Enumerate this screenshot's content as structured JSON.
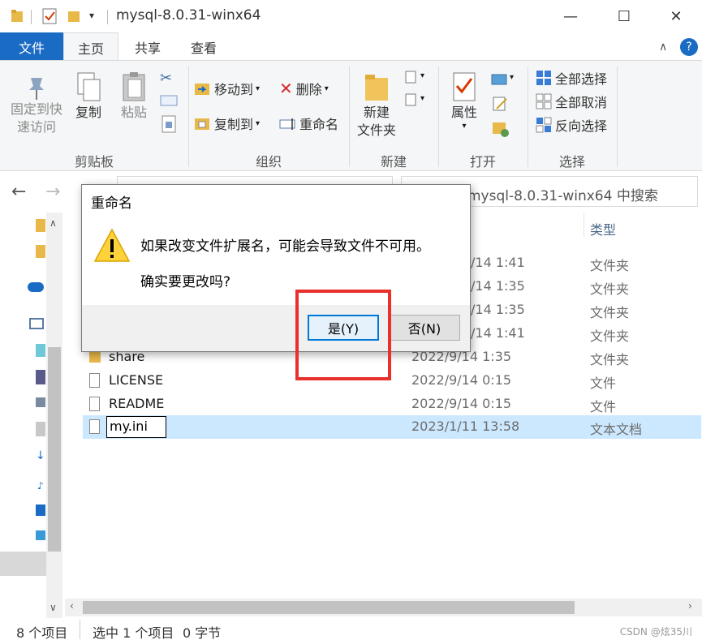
{
  "window": {
    "title": "mysql-8.0.31-winx64",
    "minimize": "—",
    "maximize": "☐",
    "close": "✕"
  },
  "tabs": [
    "文件",
    "主页",
    "共享",
    "查看"
  ],
  "ribbon": {
    "clipboard": {
      "pin_label_1": "固定到快",
      "pin_label_2": "速访问",
      "copy_label": "复制",
      "paste_label": "粘贴",
      "group_label": "剪贴板"
    },
    "organize": {
      "move_to": "移动到",
      "copy_to": "复制到",
      "delete": "删除",
      "rename": "重命名",
      "group_label": "组织"
    },
    "new": {
      "new_folder_1": "新建",
      "new_folder_2": "文件夹",
      "group_label": "新建"
    },
    "open": {
      "properties": "属性",
      "group_label": "打开"
    },
    "select": {
      "select_all": "全部选择",
      "select_none": "全部取消",
      "invert": "反向选择",
      "group_label": "选择"
    }
  },
  "search": {
    "placeholder": "mysql-8.0.31-winx64 中搜索"
  },
  "list": {
    "col_type": "类型",
    "rows": [
      {
        "name": "",
        "date": "2022/9/14 1:41",
        "type": "文件夹"
      },
      {
        "name": "",
        "date": "2022/9/14 1:35",
        "type": "文件夹"
      },
      {
        "name": "",
        "date": "2022/9/14 1:35",
        "type": "文件夹"
      },
      {
        "name": "",
        "date": "2022/9/14 1:41",
        "type": "文件夹"
      },
      {
        "name": "share",
        "date": "2022/9/14 1:35",
        "type": "文件夹"
      },
      {
        "name": "LICENSE",
        "date": "2022/9/14 0:15",
        "type": "文件"
      },
      {
        "name": "README",
        "date": "2022/9/14 0:15",
        "type": "文件"
      },
      {
        "name": "my.ini",
        "date": "2023/1/11 13:58",
        "type": "文本文档"
      }
    ],
    "partial_dates": [
      "/14 1:41",
      "/14 1:35",
      "/14 1:35",
      "/14 1:41"
    ]
  },
  "dialog": {
    "title": "重命名",
    "message": "如果改变文件扩展名，可能会导致文件不可用。",
    "question": "确实要更改吗?",
    "yes_label": "是(Y)",
    "no_label": "否(N)"
  },
  "status": {
    "item_count": "8 个项目",
    "selected": "选中 1 个项目",
    "size": "0 字节"
  },
  "watermark": "CSDN @炫35川",
  "colors": {
    "accent": "#1a6bc4",
    "highlight": "#e8302c",
    "selection": "#cce8ff"
  }
}
